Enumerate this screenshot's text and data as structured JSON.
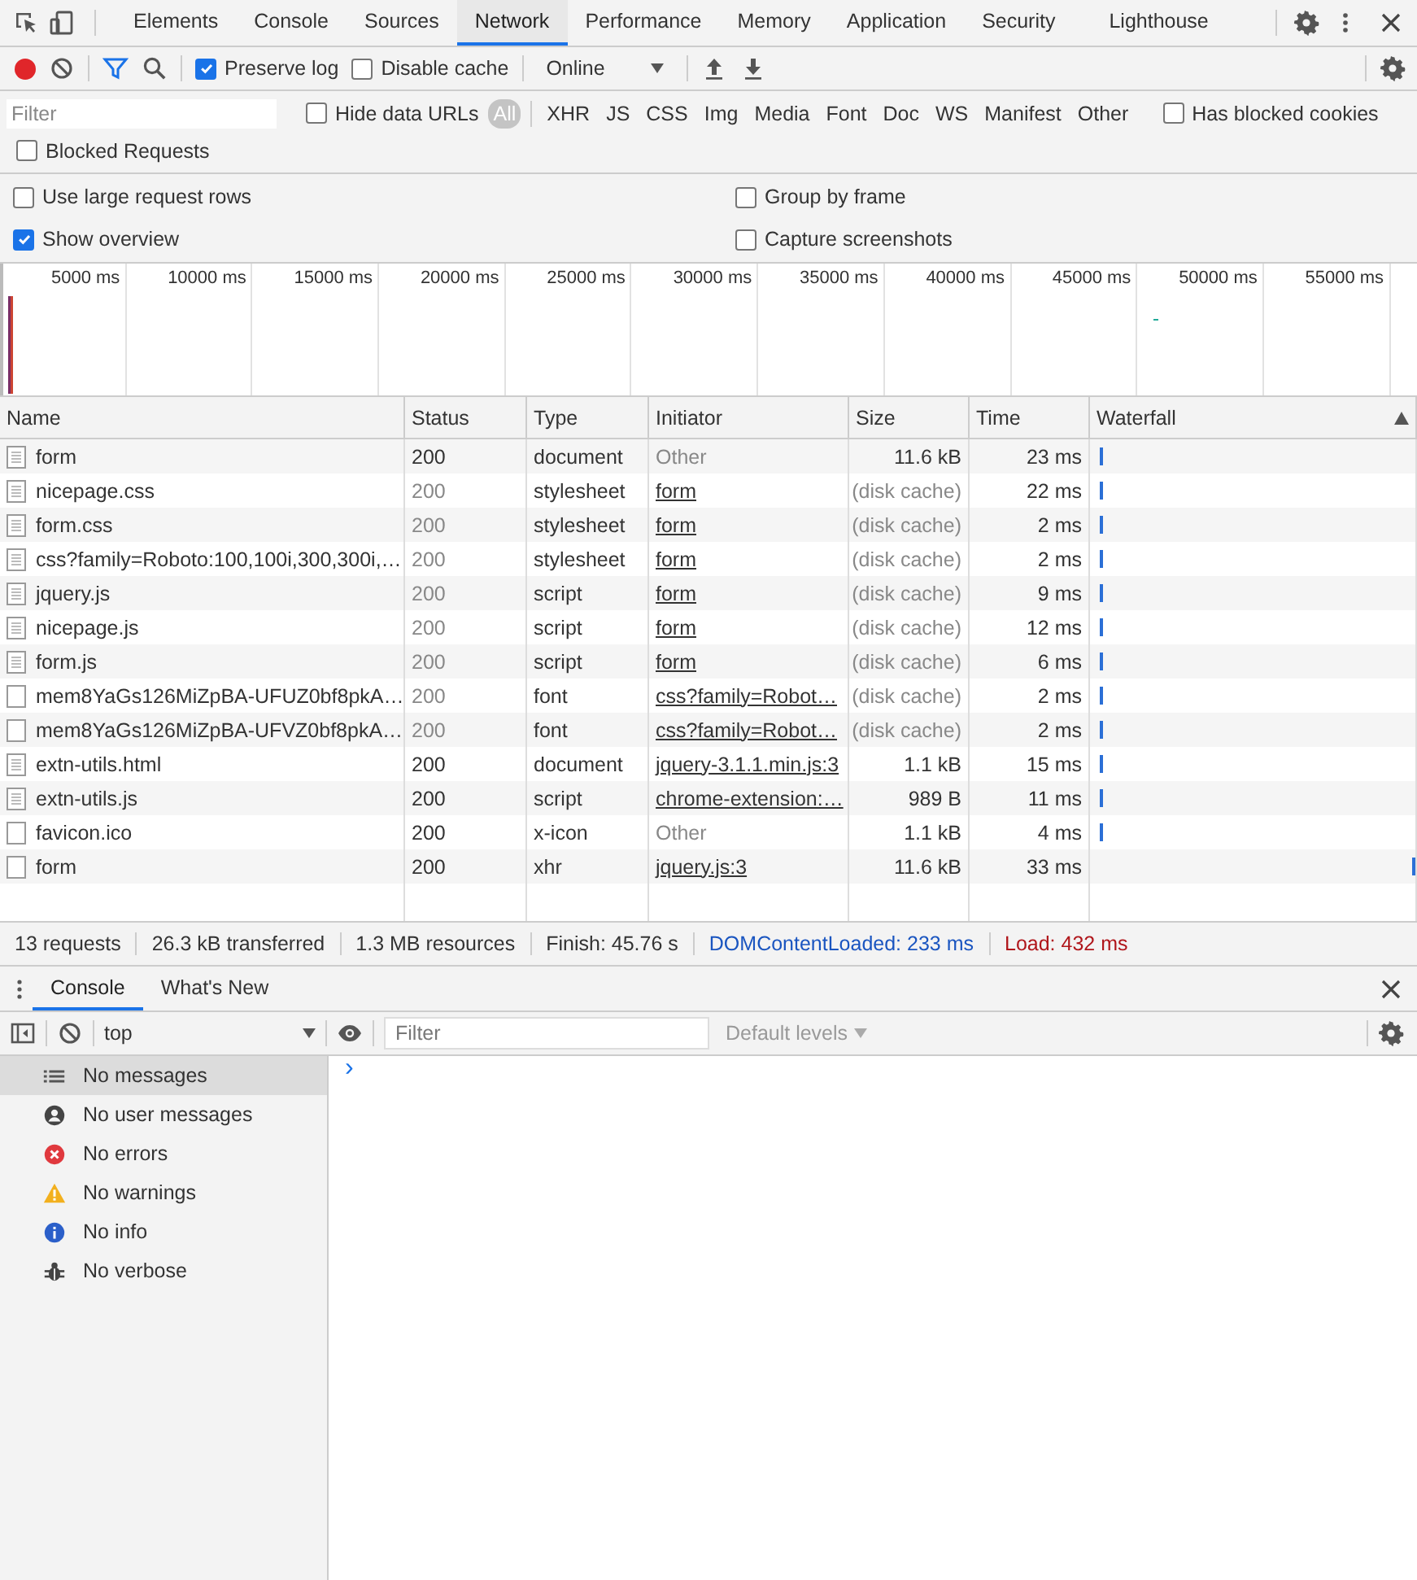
{
  "main_tabs": [
    {
      "label": "Elements",
      "selected": false
    },
    {
      "label": "Console",
      "selected": false
    },
    {
      "label": "Sources",
      "selected": false
    },
    {
      "label": "Network",
      "selected": true
    },
    {
      "label": "Performance",
      "selected": false
    },
    {
      "label": "Memory",
      "selected": false
    },
    {
      "label": "Application",
      "selected": false
    },
    {
      "label": "Security",
      "selected": false
    },
    {
      "label": "Lighthouse",
      "selected": false
    }
  ],
  "toolbar": {
    "recording": true,
    "preserve_log": {
      "label": "Preserve log",
      "checked": true
    },
    "disable_cache": {
      "label": "Disable cache",
      "checked": false
    },
    "throttling": "Online"
  },
  "filter_bar": {
    "placeholder": "Filter",
    "hide_data_urls": {
      "label": "Hide data URLs",
      "checked": false
    },
    "types": [
      {
        "label": "All",
        "selected": true
      },
      {
        "label": "XHR",
        "selected": false
      },
      {
        "label": "JS",
        "selected": false
      },
      {
        "label": "CSS",
        "selected": false
      },
      {
        "label": "Img",
        "selected": false
      },
      {
        "label": "Media",
        "selected": false
      },
      {
        "label": "Font",
        "selected": false
      },
      {
        "label": "Doc",
        "selected": false
      },
      {
        "label": "WS",
        "selected": false
      },
      {
        "label": "Manifest",
        "selected": false
      },
      {
        "label": "Other",
        "selected": false
      }
    ],
    "has_blocked_cookies": {
      "label": "Has blocked cookies",
      "checked": false
    },
    "blocked_requests": {
      "label": "Blocked Requests",
      "checked": false
    }
  },
  "settings": [
    {
      "label": "Use large request rows",
      "checked": false
    },
    {
      "label": "Group by frame",
      "checked": false
    },
    {
      "label": "Show overview",
      "checked": true
    },
    {
      "label": "Capture screenshots",
      "checked": false
    }
  ],
  "overview": {
    "ticks": [
      "5000 ms",
      "10000 ms",
      "15000 ms",
      "20000 ms",
      "25000 ms",
      "30000 ms",
      "35000 ms",
      "40000 ms",
      "45000 ms",
      "50000 ms",
      "55000 ms"
    ]
  },
  "table": {
    "columns": [
      "Name",
      "Status",
      "Type",
      "Initiator",
      "Size",
      "Time",
      "Waterfall"
    ],
    "rows": [
      {
        "name": "form",
        "kind": "document",
        "status": "200",
        "type": "document",
        "initiator": "Other",
        "initiator_link": false,
        "size": "11.6 kB",
        "cached": false,
        "time": "23 ms"
      },
      {
        "name": "nicepage.css",
        "kind": "document",
        "status": "200",
        "type": "stylesheet",
        "initiator": "form",
        "initiator_link": true,
        "size": "(disk cache)",
        "cached": true,
        "time": "22 ms"
      },
      {
        "name": "form.css",
        "kind": "document",
        "status": "200",
        "type": "stylesheet",
        "initiator": "form",
        "initiator_link": true,
        "size": "(disk cache)",
        "cached": true,
        "time": "2 ms"
      },
      {
        "name": "css?family=Roboto:100,100i,300,300i,…",
        "kind": "document",
        "status": "200",
        "type": "stylesheet",
        "initiator": "form",
        "initiator_link": true,
        "size": "(disk cache)",
        "cached": true,
        "time": "2 ms"
      },
      {
        "name": "jquery.js",
        "kind": "document",
        "status": "200",
        "type": "script",
        "initiator": "form",
        "initiator_link": true,
        "size": "(disk cache)",
        "cached": true,
        "time": "9 ms"
      },
      {
        "name": "nicepage.js",
        "kind": "document",
        "status": "200",
        "type": "script",
        "initiator": "form",
        "initiator_link": true,
        "size": "(disk cache)",
        "cached": true,
        "time": "12 ms"
      },
      {
        "name": "form.js",
        "kind": "document",
        "status": "200",
        "type": "script",
        "initiator": "form",
        "initiator_link": true,
        "size": "(disk cache)",
        "cached": true,
        "time": "6 ms"
      },
      {
        "name": "mem8YaGs126MiZpBA-UFUZ0bf8pkA…",
        "kind": "blank",
        "status": "200",
        "type": "font",
        "initiator": "css?family=Robot…",
        "initiator_link": true,
        "size": "(disk cache)",
        "cached": true,
        "time": "2 ms"
      },
      {
        "name": "mem8YaGs126MiZpBA-UFVZ0bf8pkA…",
        "kind": "blank",
        "status": "200",
        "type": "font",
        "initiator": "css?family=Robot…",
        "initiator_link": true,
        "size": "(disk cache)",
        "cached": true,
        "time": "2 ms"
      },
      {
        "name": "extn-utils.html",
        "kind": "document",
        "status": "200",
        "type": "document",
        "initiator": "jquery-3.1.1.min.js:3",
        "initiator_link": true,
        "size": "1.1 kB",
        "cached": false,
        "time": "15 ms"
      },
      {
        "name": "extn-utils.js",
        "kind": "document",
        "status": "200",
        "type": "script",
        "initiator": "chrome-extension:…",
        "initiator_link": true,
        "size": "989 B",
        "cached": false,
        "time": "11 ms"
      },
      {
        "name": "favicon.ico",
        "kind": "blank",
        "status": "200",
        "type": "x-icon",
        "initiator": "Other",
        "initiator_link": false,
        "size": "1.1 kB",
        "cached": false,
        "time": "4 ms"
      },
      {
        "name": "form",
        "kind": "blank",
        "status": "200",
        "type": "xhr",
        "initiator": "jquery.js:3",
        "initiator_link": true,
        "size": "11.6 kB",
        "cached": false,
        "time": "33 ms"
      }
    ]
  },
  "status_bar": [
    {
      "text": "13 requests",
      "kind": "plain"
    },
    {
      "text": "26.3 kB transferred",
      "kind": "plain"
    },
    {
      "text": "1.3 MB resources",
      "kind": "plain"
    },
    {
      "text": "Finish: 45.76 s",
      "kind": "plain"
    },
    {
      "text": "DOMContentLoaded: 233 ms",
      "kind": "dom"
    },
    {
      "text": "Load: 432 ms",
      "kind": "load"
    }
  ],
  "drawer_tabs": [
    {
      "label": "Console",
      "selected": true
    },
    {
      "label": "What's New",
      "selected": false
    }
  ],
  "console_toolbar": {
    "context": "top",
    "filter_placeholder": "Filter",
    "levels": "Default levels"
  },
  "console_sidebar": [
    {
      "label": "No messages",
      "kind": "messages",
      "selected": true
    },
    {
      "label": "No user messages",
      "kind": "user",
      "selected": false
    },
    {
      "label": "No errors",
      "kind": "error",
      "selected": false
    },
    {
      "label": "No warnings",
      "kind": "warning",
      "selected": false
    },
    {
      "label": "No info",
      "kind": "info",
      "selected": false
    },
    {
      "label": "No verbose",
      "kind": "verbose",
      "selected": false
    }
  ],
  "console_prompt": "›"
}
